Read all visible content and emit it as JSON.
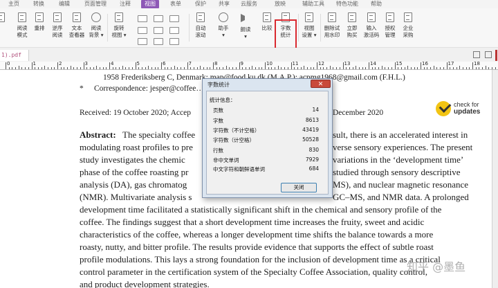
{
  "menu": {
    "items": [
      {
        "label": "主页"
      },
      {
        "label": "转换"
      },
      {
        "label": "编辑"
      },
      {
        "label": "页面管理"
      },
      {
        "label": "注释"
      },
      {
        "label": "视图",
        "active": true
      },
      {
        "label": "表单"
      },
      {
        "label": "保护"
      },
      {
        "label": "共享"
      },
      {
        "label": "云服务"
      },
      {
        "label": "放映"
      },
      {
        "label": "辅助工具"
      },
      {
        "label": "特色功能"
      },
      {
        "label": "帮助"
      }
    ]
  },
  "toolbar": {
    "read_mode": "阅读\n模式",
    "reflow": "重排",
    "reverse_read": "逆序\n阅读",
    "text_viewer": "文本\n查看器",
    "read_bg": "阅读\n背景 ▾",
    "rotate_view": "旋转\n视图 ▾",
    "auto_scroll": "自动\n滚动",
    "assistant": "助手\n▾",
    "read_aloud": "朗读\n▾",
    "compare": "比较",
    "word_count": "字数\n统计",
    "view_settings": "视图\n设置 ▾",
    "remove_watermark": "删除试\n用水印",
    "buy_now": "立即\n购买",
    "enter_activation": "输入\n激活码",
    "license_mgmt": "授权\n管理",
    "enterprise_purchase": "企业\n采购"
  },
  "tabbar": {
    "doc_tab": "1).pdf"
  },
  "ruler": {
    "numbers": [
      "0",
      "1",
      "2",
      "3",
      "4",
      "5",
      "6",
      "7",
      "8",
      "9",
      "10",
      "11",
      "12",
      "13",
      "14",
      "15",
      "16",
      "17",
      "18"
    ]
  },
  "document": {
    "lines": [
      "1958 Frederiksberg C, Denmark; map@food.ku.dk (M.A.P.); acpmg1968@gmail.com (F.H.L.)",
      "Correspondence: jesper@coffee…",
      "Received: 19 October 2020; Accep",
      "December 2020",
      "Abstract:",
      "The specialty coffee",
      "sult, there is an accelerated interest in",
      "modulating roast profiles to pre",
      "verse sensory experiences. The present",
      "study investigates the chemic",
      "variations in the ‘development time’",
      "phase of the coffee roasting pr",
      "studied through sensory descriptive",
      "analysis (DA), gas chromatog",
      "MS), and nuclear magnetic resonance",
      "(NMR). Multivariate analysis s",
      "GC–MS, and NMR data. A prolonged",
      "development time facilitated a statistically significant shift in the chemical and sensory profile of the",
      "coffee. The findings suggest that a short development time increases the fruity, sweet and acidic",
      "characteristics of the coffee, whereas a longer development time shifts the balance towards a more",
      "roasty, nutty, and bitter profile. The results provide evidence that supports the effect of subtle roast",
      "profile modulations. This lays a strong foundation for the inclusion of development time as a critical",
      "control parameter in the certification system of the Specialty Coffee Association, quality control,",
      "and product development strategies."
    ],
    "bullet": "*",
    "badge_line1": "check for",
    "badge_line2": "updates",
    "watermark": "知乎 @墨鱼"
  },
  "dialog": {
    "title": "字数统计",
    "close_x": "✕",
    "info_label": "统计信息：",
    "stats": [
      {
        "label": "页数",
        "value": "14"
      },
      {
        "label": "字数",
        "value": "8613"
      },
      {
        "label": "字符数（不计空格）",
        "value": "43419"
      },
      {
        "label": "字符数（计空格）",
        "value": "50528"
      },
      {
        "label": "行数",
        "value": "830"
      },
      {
        "label": "非中文单词",
        "value": "7929"
      },
      {
        "label": "中文字符和朝鲜语单词",
        "value": "684"
      }
    ],
    "close_button": "关闭"
  },
  "colors": {
    "menu_active": "#8e58b6",
    "highlight_border": "#d9282e",
    "badge_yellow": "#f2c414",
    "dialog_bg": "#dbe5f0"
  }
}
